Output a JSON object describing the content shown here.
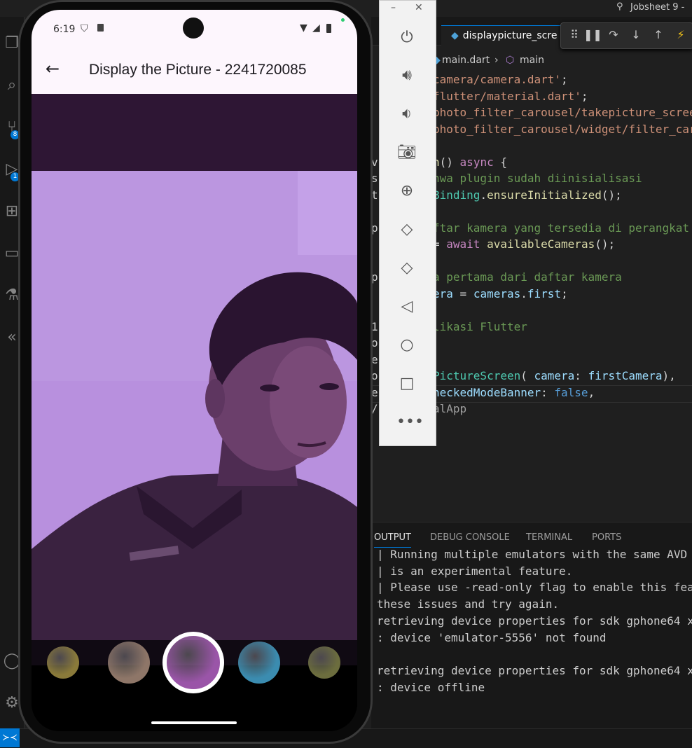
{
  "vscode": {
    "title": "Jobsheet 9 -",
    "tab": {
      "label": "displaypicture_scre"
    },
    "breadcrumb": {
      "file": "main.dart",
      "symbol": "main"
    },
    "code_lines": [
      {
        "gutter": "",
        "segments": [
          [
            "str",
            "camera/camera.dart'"
          ],
          [
            "pl",
            ";"
          ]
        ]
      },
      {
        "gutter": "",
        "segments": [
          [
            "str",
            "flutter/material.dart'"
          ],
          [
            "pl",
            ";"
          ]
        ]
      },
      {
        "gutter": "",
        "segments": [
          [
            "str",
            "photo_filter_carousel/takepicture_scree"
          ]
        ]
      },
      {
        "gutter": "",
        "segments": [
          [
            "str",
            "photo_filter_carousel/widget/filter_car"
          ]
        ]
      },
      {
        "gutter": "",
        "segments": []
      },
      {
        "gutter": "v",
        "segments": [
          [
            "fn",
            "n"
          ],
          [
            "pl",
            "() "
          ],
          [
            "kw",
            "async"
          ],
          [
            "pl",
            " {"
          ]
        ]
      },
      {
        "gutter": "s",
        "segments": [
          [
            "cm",
            "hwa plugin sudah diinisialisasi"
          ]
        ]
      },
      {
        "gutter": "t",
        "segments": [
          [
            "ty",
            "Binding"
          ],
          [
            "pl",
            "."
          ],
          [
            "fn",
            "ensureInitialized"
          ],
          [
            "pl",
            "();"
          ]
        ]
      },
      {
        "gutter": "",
        "segments": []
      },
      {
        "gutter": "p",
        "segments": [
          [
            "cm",
            "ftar kamera yang tersedia di perangkat"
          ]
        ]
      },
      {
        "gutter": "",
        "segments": [
          [
            "pl",
            "= "
          ],
          [
            "kw",
            "await"
          ],
          [
            "pl",
            " "
          ],
          [
            "fn",
            "availableCameras"
          ],
          [
            "pl",
            "();"
          ]
        ]
      },
      {
        "gutter": "",
        "segments": []
      },
      {
        "gutter": "p",
        "segments": [
          [
            "cm",
            "a pertama dari daftar kamera"
          ]
        ]
      },
      {
        "gutter": "",
        "segments": [
          [
            "var",
            "era"
          ],
          [
            "pl",
            " = "
          ],
          [
            "var",
            "cameras"
          ],
          [
            "pl",
            "."
          ],
          [
            "var",
            "first"
          ],
          [
            "pl",
            ";"
          ]
        ]
      },
      {
        "gutter": "",
        "segments": []
      },
      {
        "gutter": "1",
        "segments": [
          [
            "cm",
            "likasi Flutter"
          ]
        ]
      },
      {
        "gutter": "o",
        "segments": []
      },
      {
        "gutter": "e",
        "segments": []
      },
      {
        "gutter": "o",
        "segments": [
          [
            "ty",
            "PictureScreen"
          ],
          [
            "pl",
            "( "
          ],
          [
            "var",
            "camera"
          ],
          [
            "pl",
            ": "
          ],
          [
            "var",
            "firstCamera"
          ],
          [
            "pl",
            "),"
          ]
        ]
      },
      {
        "gutter": "e",
        "segments": [
          [
            "var",
            "heckedModeBanner"
          ],
          [
            "pl",
            ": "
          ],
          [
            "kw2",
            "false"
          ],
          [
            "pl",
            ","
          ]
        ]
      },
      {
        "gutter": "/",
        "segments": [
          [
            "cm2",
            "alApp"
          ]
        ]
      }
    ],
    "panel": {
      "tabs": [
        "OUTPUT",
        "DEBUG CONSOLE",
        "TERMINAL",
        "PORTS"
      ],
      "output_lines": [
        "| Running multiple emulators with the same AVD",
        "| is an experimental feature.",
        "| Please use -read-only flag to enable this fea",
        "these issues and try again.",
        "retrieving device properties for sdk gphone64 x",
        ": device 'emulator-5556' not found",
        "",
        "retrieving device properties for sdk gphone64 x",
        ": device offline"
      ]
    },
    "activity_badges": [
      "8",
      "1"
    ]
  },
  "emulator_toolbar": {
    "items": [
      "power-icon",
      "volume-up-icon",
      "volume-down-icon",
      "camera-icon",
      "zoom-icon",
      "rotate-left-icon",
      "rotate-right-icon",
      "back-icon",
      "home-icon",
      "overview-icon",
      "more-icon"
    ]
  },
  "phone": {
    "status": {
      "time": "6:19"
    },
    "appbar": {
      "title": "Display the Picture - 2241720085"
    },
    "filters": [
      {
        "name": "filter-yellow",
        "color": "#8a7a3a"
      },
      {
        "name": "filter-brown",
        "color": "#8e7668"
      },
      {
        "name": "filter-purple",
        "color": "#9a55a8",
        "selected": true
      },
      {
        "name": "filter-cyan",
        "color": "#3b8cb0"
      },
      {
        "name": "filter-olive",
        "color": "#6c6d3e"
      }
    ],
    "colors": {
      "appbar_bg": "#fdf6fd",
      "photo_tint": "#b890de",
      "selected_ring": "#ffffff"
    }
  }
}
